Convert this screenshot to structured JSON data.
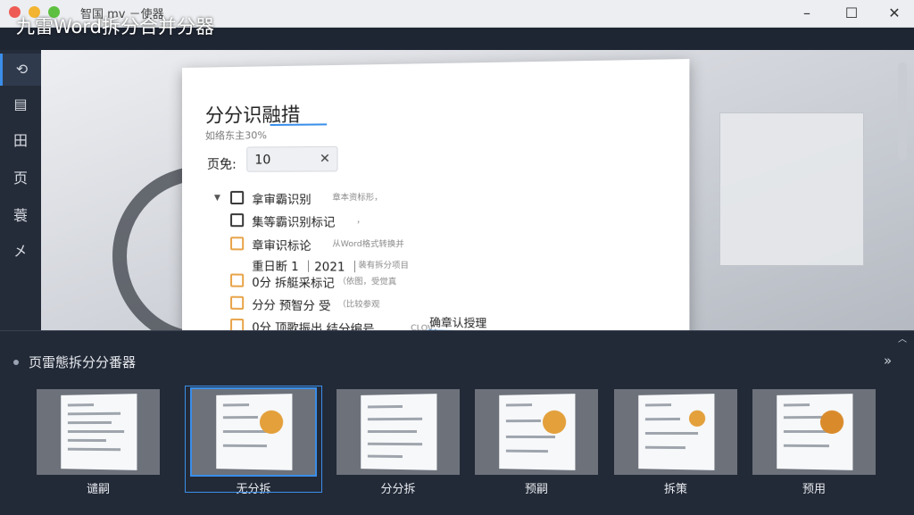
{
  "window": {
    "title": "智国 mv －使器",
    "app_title": "九雷Word拆分合并分器",
    "min": "–",
    "max": "☐",
    "close": "✕"
  },
  "sidebar": {
    "items": [
      {
        "label": "⟲",
        "icon": "sync-icon"
      },
      {
        "label": "▤",
        "icon": "document-icon"
      },
      {
        "label": "田",
        "icon": "grid-icon"
      },
      {
        "label": "页",
        "icon": "page-icon"
      },
      {
        "label": "蓑",
        "icon": "list-icon"
      },
      {
        "label": "㐅",
        "icon": "tools-icon"
      }
    ]
  },
  "doc": {
    "title": "分分识融措",
    "subtitle": "如络东主30%",
    "page_label": "页免:",
    "page_value": "10",
    "clear": "✕",
    "options": [
      {
        "label": "拿审霸识别",
        "desc": "章本资标形，"
      },
      {
        "label": "集等霸识别标记",
        "desc": "，"
      },
      {
        "label": "章审识标论",
        "desc": "从Word格式转换并"
      },
      {
        "label": "重日断 1 ｜2021 ｜",
        "desc": "装有拆分项目"
      },
      {
        "label": "0分  拆艇采标记",
        "desc": "（依图，受觉真"
      },
      {
        "label": "分分 预智分 受",
        "desc": "（比较参观"
      },
      {
        "label": "0分  顶歌振出 结分编号",
        "desc": "CLOV，"
      }
    ],
    "confirm": "确章认授理"
  },
  "bottom": {
    "title": "页雷態拆分分番器",
    "more": "»",
    "collapse": "︿",
    "thumbs": [
      {
        "label": "谴嗣"
      },
      {
        "label": "无分拆"
      },
      {
        "label": "分分拆"
      },
      {
        "label": "预嗣"
      },
      {
        "label": "拆策"
      },
      {
        "label": "预用"
      }
    ]
  },
  "colors": {
    "accent": "#3a8eea",
    "checkbox_orange": "#e8a44a",
    "panel": "#232a37"
  }
}
